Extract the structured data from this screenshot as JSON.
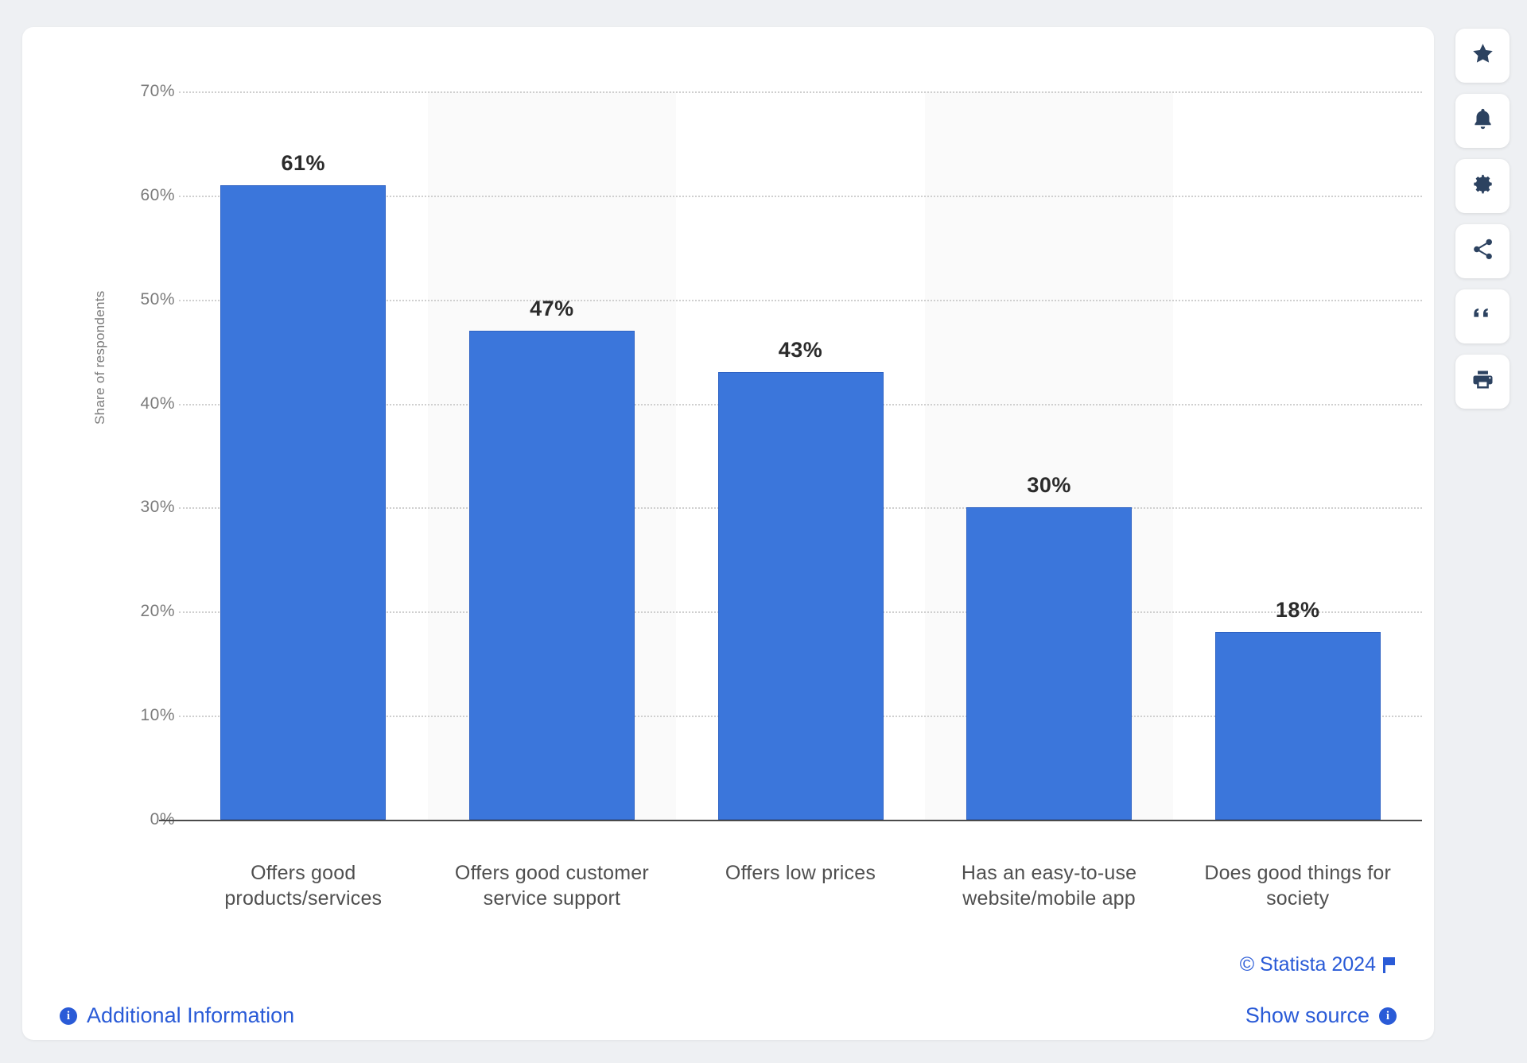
{
  "chart_data": {
    "type": "bar",
    "title": "",
    "subtitle": "",
    "xlabel": "",
    "ylabel": "Share of respondents",
    "ylim": [
      0,
      70
    ],
    "ytick_labels": [
      "0%",
      "10%",
      "20%",
      "30%",
      "40%",
      "50%",
      "60%",
      "70%"
    ],
    "ytick_values": [
      0,
      10,
      20,
      30,
      40,
      50,
      60,
      70
    ],
    "grid": true,
    "legend": "none",
    "categories": [
      "Offers good products/services",
      "Offers good customer service support",
      "Offers low prices",
      "Has an easy-to-use website/mobile app",
      "Does good things for society"
    ],
    "category_lines": [
      [
        "Offers good",
        "products/services"
      ],
      [
        "Offers good customer",
        "service support"
      ],
      [
        "Offers low prices"
      ],
      [
        "Has an easy-to-use",
        "website/mobile app"
      ],
      [
        "Does good things for",
        "society"
      ]
    ],
    "values": [
      61,
      47,
      43,
      30,
      18
    ],
    "data_labels": [
      "61%",
      "47%",
      "43%",
      "30%",
      "18%"
    ],
    "bar_color": "#3b76db",
    "bar_border_color": "#2f63c4"
  },
  "footer": {
    "copyright": "© Statista 2024",
    "additional_information": "Additional Information",
    "show_source": "Show source",
    "info_glyph": "i",
    "link_color": "#2a5bd7"
  },
  "toolbar": {
    "items": [
      {
        "name": "favorite",
        "label": "Add to favorites"
      },
      {
        "name": "notification",
        "label": "Notifications"
      },
      {
        "name": "settings",
        "label": "Settings"
      },
      {
        "name": "share",
        "label": "Share"
      },
      {
        "name": "citation",
        "label": "Citation"
      },
      {
        "name": "print",
        "label": "Print"
      }
    ]
  }
}
